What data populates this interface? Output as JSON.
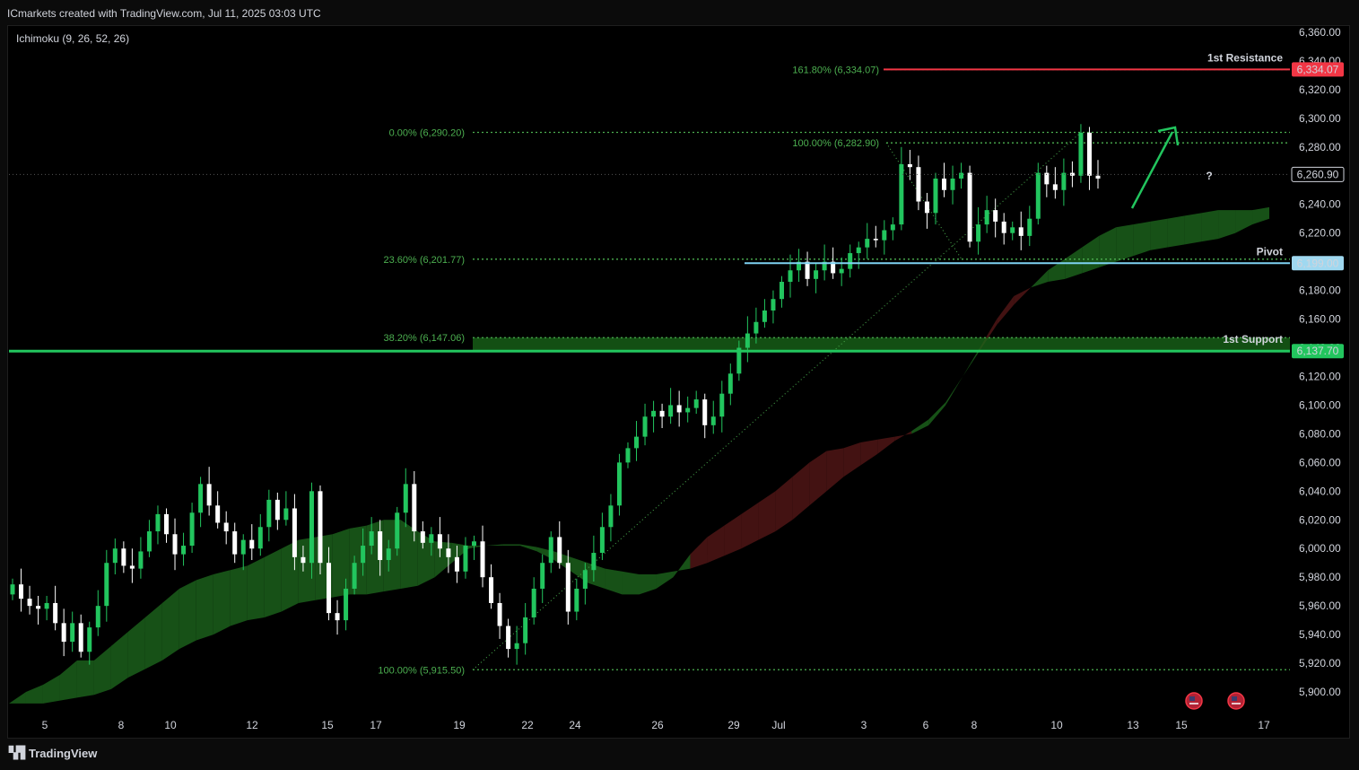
{
  "header": {
    "title": "ICmarkets created with TradingView.com, Jul 11, 2025 03:03 UTC"
  },
  "indicator": {
    "label": "Ichimoku (9, 26, 52, 26)"
  },
  "footer": {
    "brand": "TradingView"
  },
  "colors": {
    "up": "#22c55e",
    "down": "#ffffff",
    "cloud_bull": "#1a5a1a",
    "cloud_bear": "#4a1414",
    "fib": "#4caf50",
    "resistance": "#f23645",
    "support": "#22c55e",
    "pivot": "#7fd3f2"
  },
  "chart_data": {
    "type": "candlestick",
    "ylim": [
      5885,
      6365
    ],
    "yticks": [
      "6,360.00",
      "6,340.00",
      "6,320.00",
      "6,300.00",
      "6,280.00",
      "6,260.00",
      "6,240.00",
      "6,220.00",
      "6,200.00",
      "6,180.00",
      "6,160.00",
      "6,140.00",
      "6,120.00",
      "6,100.00",
      "6,080.00",
      "6,060.00",
      "6,040.00",
      "6,020.00",
      "6,000.00",
      "5,980.00",
      "5,960.00",
      "5,940.00",
      "5,920.00",
      "5,900.00"
    ],
    "xticks": [
      "5",
      "8",
      "10",
      "12",
      "15",
      "17",
      "19",
      "22",
      "24",
      "26",
      "29",
      "Jul",
      "3",
      "6",
      "8",
      "10",
      "13",
      "15",
      "17"
    ],
    "fib_levels": [
      {
        "label": "161.80% (6,334.07)",
        "value": 6334.07
      },
      {
        "label": "0.00% (6,290.20)",
        "value": 6290.2
      },
      {
        "label": "100.00% (6,282.90)",
        "value": 6282.9
      },
      {
        "label": "23.60% (6,201.77)",
        "value": 6201.77
      },
      {
        "label": "38.20% (6,147.06)",
        "value": 6147.06
      },
      {
        "label": "100.00% (5,915.50)",
        "value": 5915.5
      }
    ],
    "levels": [
      {
        "name": "1st Resistance",
        "value": 6334.07,
        "price_label": "6,334.07"
      },
      {
        "name": "Pivot",
        "value": 6199.0,
        "price_label": "6,199.00"
      },
      {
        "name": "1st Support",
        "value": 6137.7,
        "price_label": "6,137.70"
      }
    ],
    "last_price": {
      "value": 6260.9,
      "label": "6,260.90"
    },
    "annotation": "?",
    "closes": [
      5975,
      5965,
      5960,
      5958,
      5962,
      5948,
      5935,
      5948,
      5928,
      5945,
      5960,
      5990,
      6000,
      5988,
      5986,
      5998,
      6012,
      6024,
      6010,
      5996,
      6002,
      6025,
      6045,
      6030,
      6018,
      6012,
      5996,
      6006,
      6000,
      6015,
      6034,
      6020,
      6028,
      5994,
      5990,
      6040,
      5990,
      5955,
      5950,
      5972,
      5990,
      6002,
      6012,
      5992,
      6000,
      6025,
      6045,
      6012,
      6004,
      6010,
      6000,
      5994,
      5984,
      6002,
      6005,
      5980,
      5962,
      5946,
      5930,
      5934,
      5952,
      5972,
      5990,
      6008,
      5990,
      5956,
      5972,
      5985,
      5997,
      6015,
      6030,
      6060,
      6070,
      6078,
      6092,
      6096,
      6092,
      6100,
      6095,
      6098,
      6104,
      6086,
      6092,
      6108,
      6122,
      6140,
      6150,
      6158,
      6166,
      6174,
      6186,
      6194,
      6200,
      6188,
      6194,
      6200,
      6192,
      6195,
      6206,
      6210,
      6216,
      6215,
      6222,
      6226,
      6268,
      6266,
      6242,
      6234,
      6258,
      6250,
      6258,
      6262,
      6214,
      6226,
      6236,
      6228,
      6220,
      6224,
      6218,
      6230,
      6262,
      6254,
      6250,
      6262,
      6260,
      6290,
      6260,
      6258
    ],
    "cloud": {
      "a": [
        5892,
        5900,
        5905,
        5912,
        5922,
        5922,
        5932,
        5942,
        5952,
        5962,
        5972,
        5978,
        5982,
        5985,
        5988,
        5994,
        6000,
        6006,
        6008,
        6010,
        6014,
        6016,
        6020,
        6020,
        6012,
        6005,
        6004,
        6002,
        6002,
        6003,
        6003,
        6001,
        5998,
        5994,
        5990,
        5986,
        5984,
        5982,
        5982,
        5984,
        5986,
        5990,
        5995,
        6000,
        6006,
        6012,
        6020,
        6030,
        6040,
        6050,
        6058,
        6066,
        6075,
        6082,
        6090,
        6102,
        6120,
        6138,
        6156,
        6170,
        6182,
        6194,
        6202,
        6210,
        6218,
        6224,
        6226,
        6228,
        6230,
        6232,
        6234,
        6236,
        6236,
        6236,
        6238
      ],
      "b": [
        5892,
        5892,
        5892,
        5894,
        5896,
        5898,
        5902,
        5910,
        5916,
        5922,
        5930,
        5936,
        5940,
        5946,
        5950,
        5952,
        5956,
        5962,
        5964,
        5966,
        5968,
        5968,
        5970,
        5972,
        5974,
        5980,
        5990,
        6000,
        6002,
        6002,
        6002,
        5998,
        5992,
        5984,
        5976,
        5972,
        5968,
        5968,
        5972,
        5980,
        5996,
        6008,
        6016,
        6024,
        6032,
        6040,
        6050,
        6060,
        6068,
        6070,
        6074,
        6076,
        6078,
        6080,
        6086,
        6100,
        6120,
        6140,
        6160,
        6176,
        6182,
        6186,
        6188,
        6192,
        6196,
        6200,
        6204,
        6208,
        6210,
        6212,
        6214,
        6216,
        6220,
        6226,
        6230
      ]
    }
  }
}
